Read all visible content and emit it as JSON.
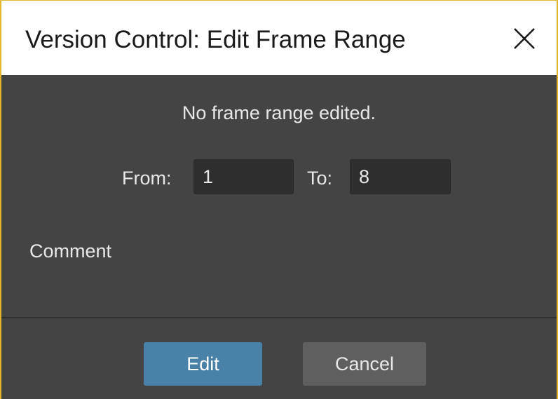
{
  "dialog": {
    "title": "Version Control: Edit Frame Range",
    "close_icon": "close-icon"
  },
  "content": {
    "status_text": "No frame range edited.",
    "from_label": "From:",
    "from_value": "1",
    "to_label": "To:",
    "to_value": "8",
    "comment_label": "Comment"
  },
  "footer": {
    "edit_label": "Edit",
    "cancel_label": "Cancel"
  },
  "colors": {
    "accent_border": "#e6b62a",
    "body_bg": "#444444",
    "input_bg": "#2e2e2e",
    "primary_button": "#4a81a8",
    "secondary_button": "#5f5f5f"
  }
}
